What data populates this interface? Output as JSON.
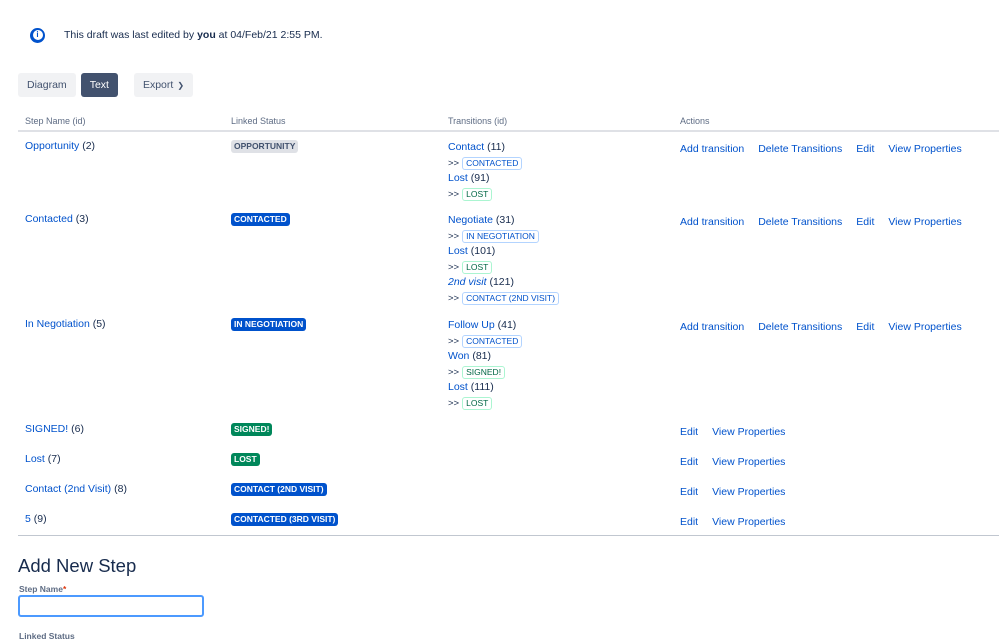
{
  "banner": {
    "prefix": "This draft was last edited by ",
    "user": "you",
    "suffix": " at 04/Feb/21 2:55 PM."
  },
  "toolbar": {
    "diagram": "Diagram",
    "text": "Text",
    "export": "Export"
  },
  "table": {
    "headers": [
      "Step Name (id)",
      "Linked Status",
      "Transitions (id)",
      "Actions"
    ],
    "rows": [
      {
        "name": "Opportunity",
        "id": "(2)",
        "status": "OPPORTUNITY",
        "status_color": "gray",
        "transitions": [
          {
            "name": "Contact",
            "id": "(11)",
            "target": "CONTACTED",
            "target_color": "blue"
          },
          {
            "name": "Lost",
            "id": "(91)",
            "target": "LOST",
            "target_color": "green"
          }
        ],
        "actions": [
          "Add transition",
          "Delete Transitions",
          "Edit",
          "View Properties"
        ]
      },
      {
        "name": "Contacted",
        "id": "(3)",
        "status": "CONTACTED",
        "status_color": "blue",
        "transitions": [
          {
            "name": "Negotiate",
            "id": "(31)",
            "target": "IN NEGOTIATION",
            "target_color": "blue"
          },
          {
            "name": "Lost",
            "id": "(101)",
            "target": "LOST",
            "target_color": "green"
          },
          {
            "name": "2nd visit",
            "id": "(121)",
            "target": "CONTACT (2ND VISIT)",
            "target_color": "blue",
            "italic": true
          }
        ],
        "actions": [
          "Add transition",
          "Delete Transitions",
          "Edit",
          "View Properties"
        ]
      },
      {
        "name": "In Negotiation",
        "id": "(5)",
        "status": "IN NEGOTIATION",
        "status_color": "blue",
        "transitions": [
          {
            "name": "Follow Up",
            "id": "(41)",
            "target": "CONTACTED",
            "target_color": "blue"
          },
          {
            "name": "Won",
            "id": "(81)",
            "target": "SIGNED!",
            "target_color": "green"
          },
          {
            "name": "Lost",
            "id": "(111)",
            "target": "LOST",
            "target_color": "green"
          }
        ],
        "actions": [
          "Add transition",
          "Delete Transitions",
          "Edit",
          "View Properties"
        ]
      },
      {
        "name": "SIGNED!",
        "id": "(6)",
        "status": "SIGNED!",
        "status_color": "green",
        "transitions": [],
        "actions": [
          "Edit",
          "View Properties"
        ]
      },
      {
        "name": "Lost",
        "id": "(7)",
        "status": "LOST",
        "status_color": "green",
        "transitions": [],
        "actions": [
          "Edit",
          "View Properties"
        ]
      },
      {
        "name": "Contact (2nd Visit)",
        "id": "(8)",
        "status": "CONTACT (2ND VISIT)",
        "status_color": "blue",
        "transitions": [],
        "actions": [
          "Edit",
          "View Properties"
        ]
      },
      {
        "name": "5",
        "id": "(9)",
        "status": "CONTACTED (3RD VISIT)",
        "status_color": "blue",
        "transitions": [],
        "actions": [
          "Edit",
          "View Properties"
        ]
      }
    ]
  },
  "add_step": {
    "title": "Add New Step",
    "step_name_label": "Step Name",
    "step_name_value": "",
    "linked_status_label": "Linked Status"
  },
  "icons": {
    "info": "info-icon",
    "export_chevron": "chevron-down-icon"
  }
}
